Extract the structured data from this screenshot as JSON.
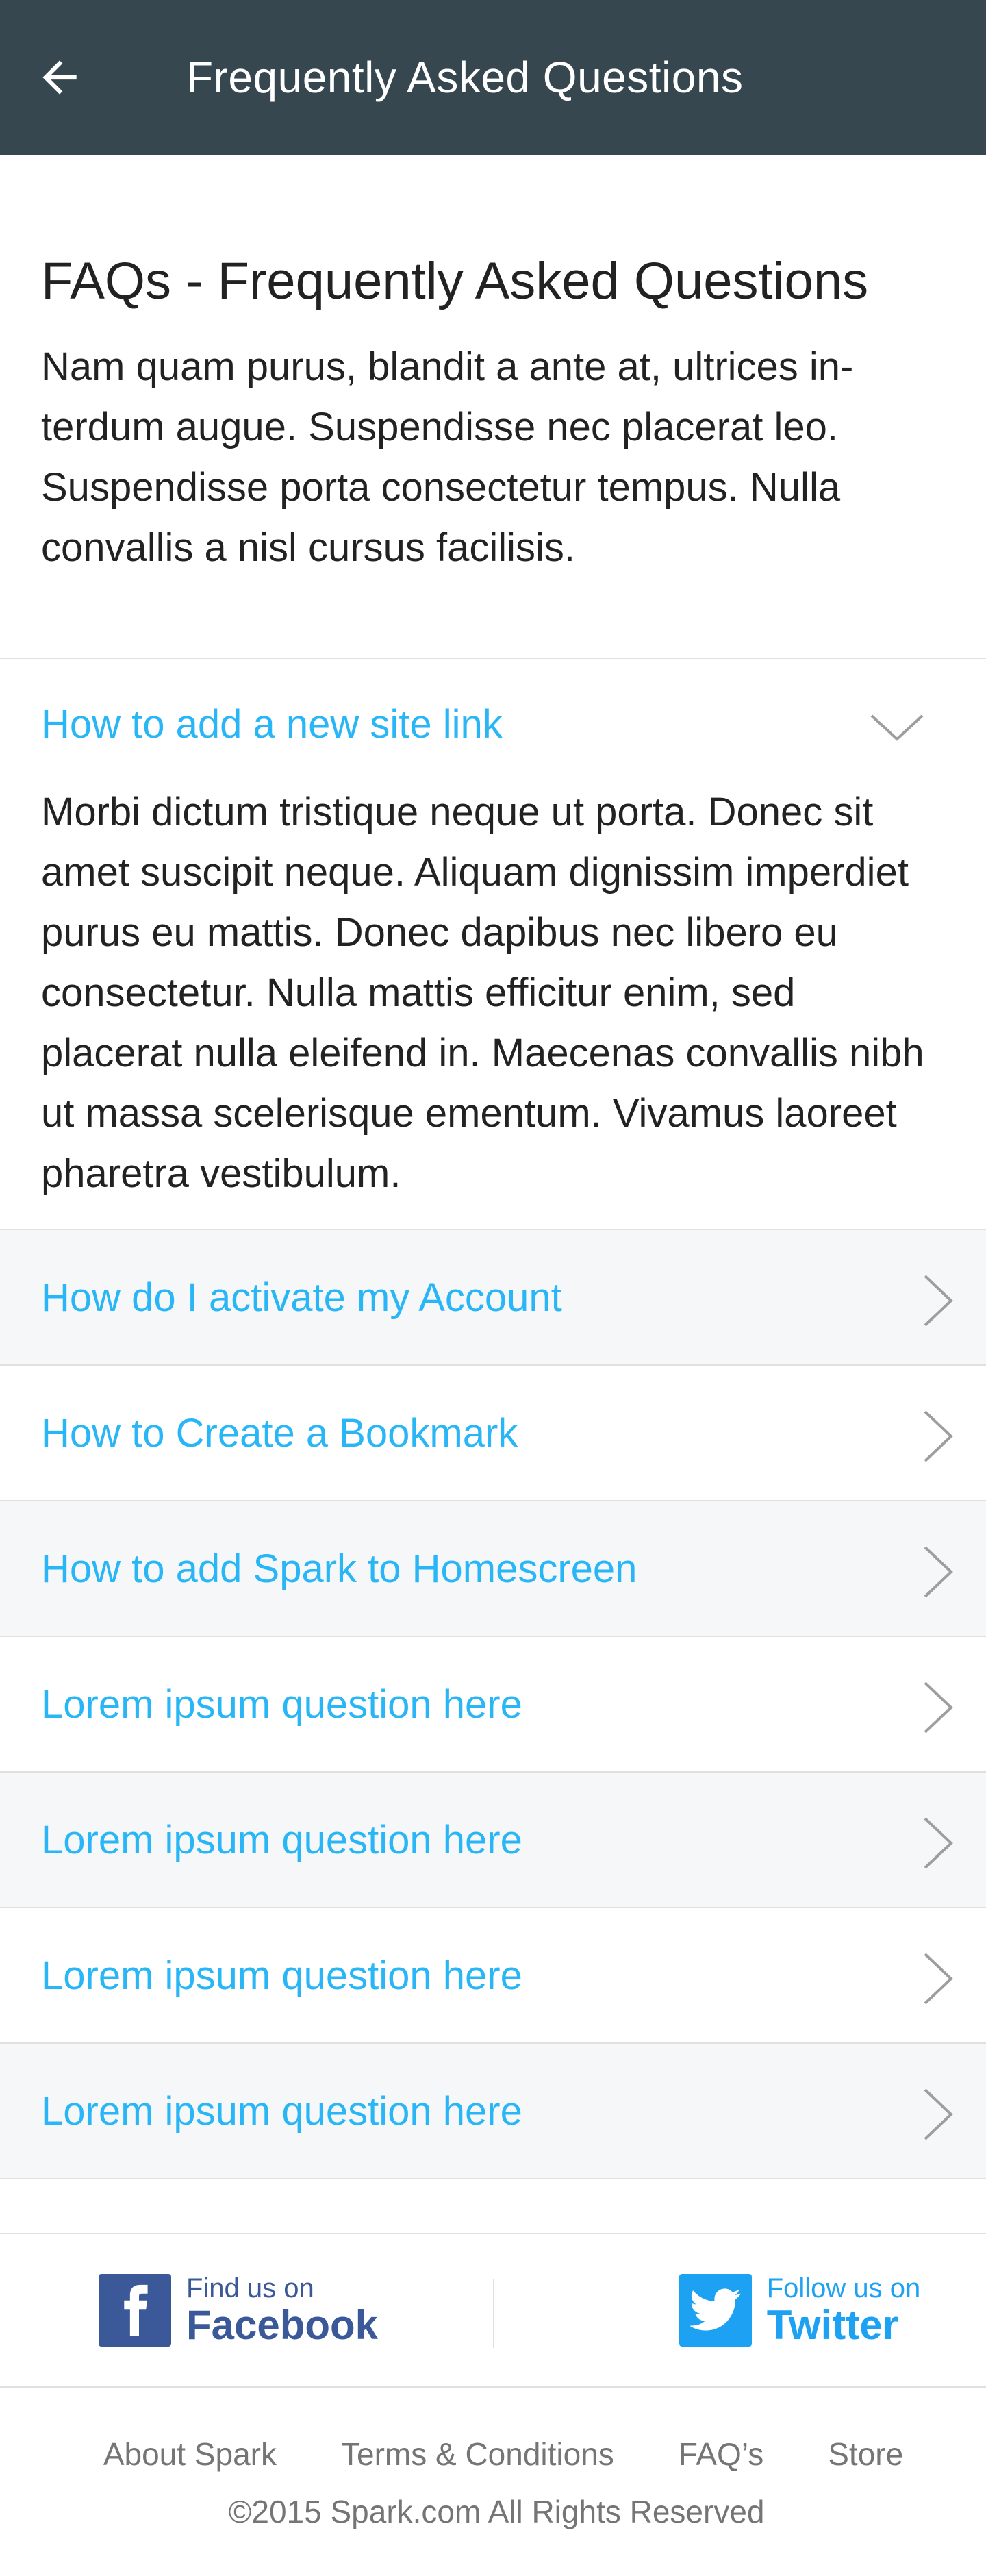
{
  "header": {
    "title": "Frequently Asked Questions",
    "back_icon": "arrow-left-icon",
    "background": "#37474f"
  },
  "intro": {
    "heading": "FAQs - Frequently Asked Questions",
    "body": "Nam quam purus, blandit a ante at, ultrices in-terdum augue. Suspendisse nec placerat leo. Suspendisse porta consectetur tempus. Nulla convallis a nisl cursus facilisis."
  },
  "faq": {
    "expanded": {
      "question": "How to add a new site link",
      "answer": "Morbi dictum tristique neque ut porta. Donec sit amet suscipit neque. Aliquam dignissim imperdiet purus eu mattis. Donec dapibus nec libero eu consectetur. Nulla mattis efficitur enim, sed placerat nulla eleifend in. Maecenas convallis nibh ut massa scelerisque ementum. Vivamus laoreet pharetra vestibulum."
    },
    "items": [
      {
        "question": "How do I activate my Account"
      },
      {
        "question": "How to Create a Bookmark"
      },
      {
        "question": "How to add Spark to Homescreen"
      },
      {
        "question": "Lorem ipsum question here"
      },
      {
        "question": "Lorem ipsum question here"
      },
      {
        "question": "Lorem ipsum question here"
      },
      {
        "question": "Lorem ipsum question here"
      }
    ],
    "accent": "#29b6f6"
  },
  "social": {
    "facebook": {
      "small": "Find us on",
      "big": "Facebook",
      "color": "#3b5998"
    },
    "twitter": {
      "small": "Follow us on",
      "big": "Twitter",
      "color": "#1da1f2"
    }
  },
  "footer": {
    "links": [
      "About Spark",
      "Terms & Conditions",
      "FAQ’s",
      "Store"
    ],
    "copyright": "©2015 Spark.com All Rights Reserved"
  }
}
